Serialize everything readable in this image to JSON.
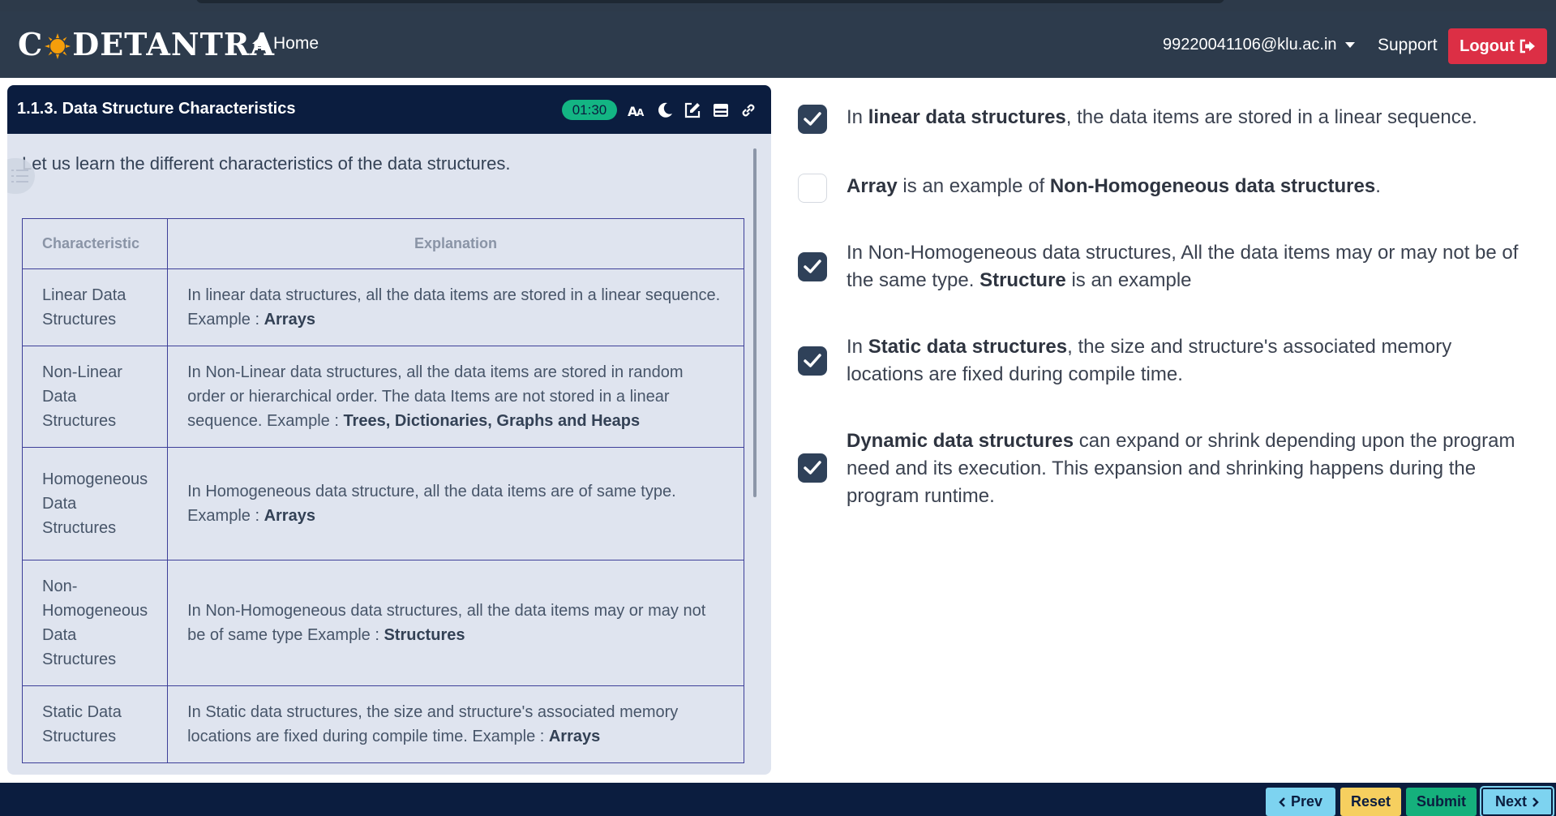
{
  "header": {
    "logo_text_1": "C",
    "logo_text_2": "DETANTRA",
    "home_label": "Home",
    "user_email": "99220041106@klu.ac.in",
    "support_label": "Support",
    "logout_label": "Logout"
  },
  "panel": {
    "title": "1.1.3. Data Structure Characteristics",
    "timer": "01:30",
    "intro": "Let us learn the different characteristics of the data structures.",
    "table": {
      "headers": [
        "Characteristic",
        "Explanation"
      ],
      "rows": [
        {
          "name": "Linear Data Structures",
          "text": "In linear data structures, all the data items are stored in a linear sequence. Example : ",
          "bold": "Arrays"
        },
        {
          "name": "Non-Linear Data Structures",
          "text": "In Non-Linear data structures, all the data items are stored in random order or hierarchical order. The data Items are not stored in a linear sequence. Example : ",
          "bold": "Trees, Dictionaries, Graphs and Heaps"
        },
        {
          "name": "Homogeneous Data Structures",
          "text": "In Homogeneous data structure, all the data items are of same type. Example : ",
          "bold": "Arrays"
        },
        {
          "name": "Non-Homogeneous Data Structures",
          "text": "In Non-Homogeneous data structures, all the data items may or may not be of same type Example : ",
          "bold": "Structures"
        },
        {
          "name": "Static Data Structures",
          "text": "In Static data structures, the size and structure's associated memory locations are fixed during compile time. Example : ",
          "bold": "Arrays"
        }
      ]
    }
  },
  "options": [
    {
      "checked": true,
      "parts": [
        "In ",
        "linear data structures",
        ", the data items are stored in a linear sequence."
      ]
    },
    {
      "checked": false,
      "parts": [
        "",
        "Array",
        " is an example of ",
        "Non-Homogeneous data structures",
        "."
      ]
    },
    {
      "checked": true,
      "parts": [
        "In Non-Homogeneous data structures, All the data items may or may not be of the same type. ",
        "Structure",
        " is an example"
      ]
    },
    {
      "checked": true,
      "parts": [
        "In ",
        "Static data structures",
        ", the size and structure's associated memory locations are fixed during compile time."
      ]
    },
    {
      "checked": true,
      "parts": [
        "",
        "Dynamic data structures",
        " can expand or shrink depending upon the program need and its execution. This expansion and shrinking happens during the program runtime."
      ]
    }
  ],
  "footer": {
    "prev_label": "Prev",
    "reset_label": "Reset",
    "submit_label": "Submit",
    "next_label": "Next"
  },
  "colors": {
    "header_bg": "#2d3b4c",
    "panel_head_bg": "#0b1d3f",
    "timer_bg": "#13b583",
    "logout_bg": "#dc2f45",
    "checkbox_checked": "#2f4159",
    "table_border": "#3d3f99"
  },
  "icons": {
    "home": "home-icon",
    "logout": "sign-out-icon",
    "font_size": "font-size-icon",
    "theme": "moon-icon",
    "edit": "edit-icon",
    "layout": "layout-icon",
    "link": "link-icon"
  }
}
